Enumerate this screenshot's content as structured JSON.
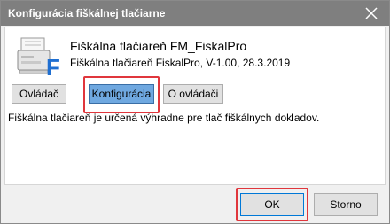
{
  "window": {
    "title": "Konfigurácia fiškálnej tlačiarne"
  },
  "header": {
    "app_name": "Fiškálna tlačiareň FM_FiskalPro",
    "app_version": "Fiškálna tlačiareň FiskalPro, V-1.00, 28.3.2019",
    "icon_letter": "F"
  },
  "tabs": [
    {
      "label": "Ovládač",
      "active": false
    },
    {
      "label": "Konfigurácia",
      "active": true
    },
    {
      "label": "O ovládači",
      "active": false
    }
  ],
  "description": "Fiškálna tlačiareň je určená výhradne pre tlač fiškálnych dokladov.",
  "footer": {
    "ok_label": "OK",
    "cancel_label": "Storno"
  },
  "colors": {
    "titlebar": "#7f7f7f",
    "active_tab": "#6fa8e0",
    "highlight": "#e0363c",
    "icon_letter": "#1f6fd1"
  },
  "icons": {
    "close": "close-icon",
    "app": "fiscal-printer-icon"
  }
}
